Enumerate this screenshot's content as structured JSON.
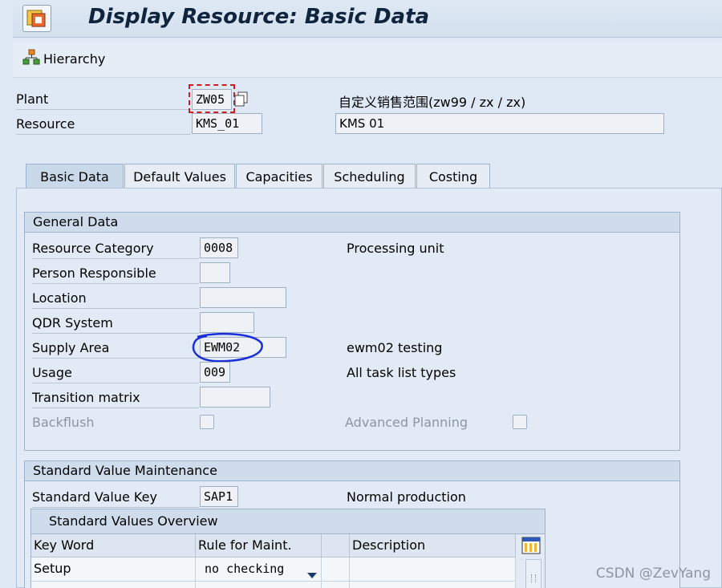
{
  "title": "Display Resource: Basic Data",
  "toolbar": {
    "hierarchy_label": "Hierarchy"
  },
  "header": {
    "plant_label": "Plant",
    "plant_value": "ZW05",
    "plant_desc": "自定义销售范围(zw99 / zx / zx)",
    "resource_label": "Resource",
    "resource_value": "KMS_01",
    "resource_desc": "KMS 01"
  },
  "tabs": [
    {
      "label": "Basic Data",
      "active": true
    },
    {
      "label": "Default Values"
    },
    {
      "label": "Capacities"
    },
    {
      "label": "Scheduling"
    },
    {
      "label": "Costing"
    }
  ],
  "general_data": {
    "title": "General Data",
    "resource_category_label": "Resource Category",
    "resource_category_value": "0008",
    "resource_category_desc": "Processing unit",
    "person_responsible_label": "Person Responsible",
    "person_responsible_value": "",
    "location_label": "Location",
    "location_value": "",
    "qdr_label": "QDR System",
    "qdr_value": "",
    "supply_area_label": "Supply Area",
    "supply_area_value": "EWM02",
    "supply_area_desc": "ewm02 testing",
    "usage_label": "Usage",
    "usage_value": "009",
    "usage_desc": "All task list types",
    "transition_label": "Transition matrix",
    "transition_value": "",
    "backflush_label": "Backflush",
    "advanced_planning_label": "Advanced Planning"
  },
  "standard_values": {
    "title": "Standard Value Maintenance",
    "key_label": "Standard Value Key",
    "key_value": "SAP1",
    "key_desc": "Normal production",
    "overview_title": "Standard Values Overview",
    "columns": [
      "Key Word",
      "Rule for Maint.",
      "",
      "Description"
    ],
    "rows": [
      {
        "key_word": "Setup",
        "rule": "no checking",
        "description": ""
      }
    ]
  },
  "watermark": "CSDN @ZevYang",
  "colors": {
    "annotation_red": "#cc1f1f",
    "annotation_blue": "#1a2fd6"
  },
  "icons": [
    "transaction-icon",
    "hierarchy-icon",
    "copy-icon",
    "dropdown-icon",
    "table-settings-icon"
  ]
}
